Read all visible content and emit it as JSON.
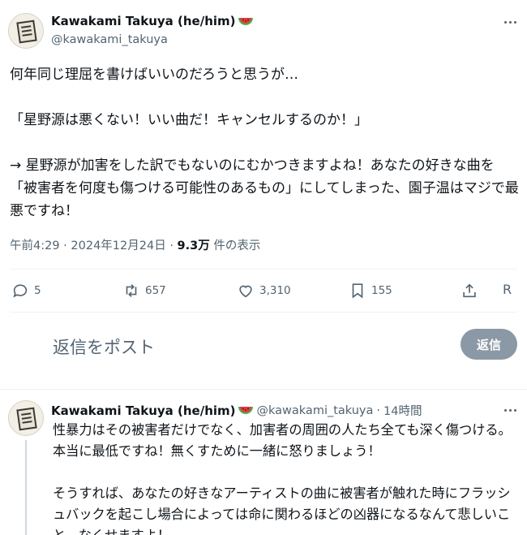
{
  "main_tweet": {
    "author": {
      "display_name": "Kawakami Takuya (he/him)",
      "handle": "@kawakami_takuya",
      "emoji_icon": "watermelon-icon"
    },
    "paragraphs": [
      "何年同じ理屈を書けばいいのだろうと思うが…",
      "「星野源は悪くない！いい曲だ！キャンセルするのか！」",
      "→ 星野源が加害をした訳でもないのにむかつきますよね！あなたの好きな曲を「被害者を何度も傷つける可能性のあるもの」にしてしまった、園子温はマジで最悪ですね！"
    ],
    "time": "午前4:29",
    "date": "2024年12月24日",
    "separator": "·",
    "views_count": "9.3万",
    "views_label": "件の表示"
  },
  "actions": {
    "replies": "5",
    "reposts": "657",
    "likes": "3,310",
    "bookmarks": "155",
    "extra_label": "R"
  },
  "reply_composer": {
    "placeholder": "返信をポスト",
    "button_label": "返信"
  },
  "reply_tweet": {
    "author": {
      "display_name": "Kawakami Takuya (he/him)",
      "handle": "@kawakami_takuya",
      "emoji_icon": "watermelon-icon"
    },
    "separator": "·",
    "time": "14時間",
    "paragraphs": [
      "性暴力はその被害者だけでなく、加害者の周囲の人たち全ても深く傷つける。本当に最低ですね！無くすために一緒に怒りましょう！",
      "そうすれば、あなたの好きなアーティストの曲に被害者が触れた時にフラッシュバックを起こし場合によっては命に関わるほどの凶器になるなんて悲しいこと、なくせますよ！"
    ]
  },
  "colors": {
    "text_primary": "#0f1419",
    "text_secondary": "#536471",
    "reply_button_bg": "#8b98a5",
    "divider": "#eff3f4"
  }
}
